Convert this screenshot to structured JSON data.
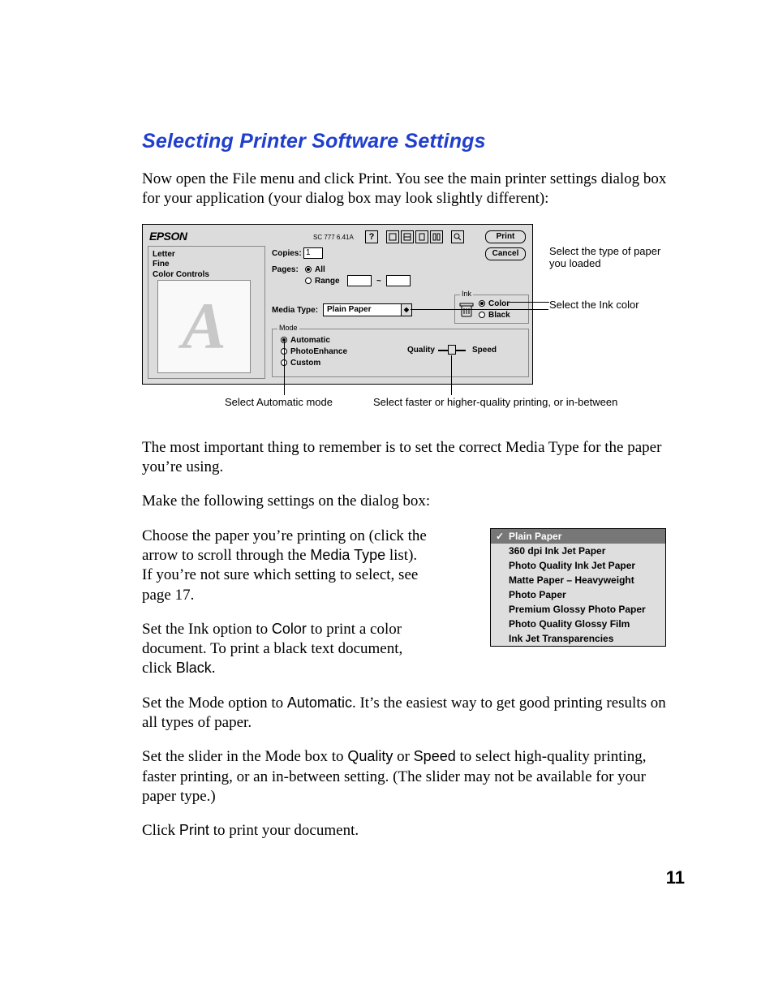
{
  "title": "Selecting Printer Software Settings",
  "intro": "Now open the File menu and click Print. You see the main printer settings dialog box for your application (your dialog box may look slightly different):",
  "after1": "The most important thing to remember is to set the correct Media Type for the paper you’re using.",
  "after2": "Make the following settings on the dialog box:",
  "step1a": "Choose the paper you’re printing on (click the arrow to scroll through the ",
  "step1_term": "Media Type",
  "step1b": " list). If you’re not sure which setting to select, see page 17.",
  "step2a": "Set the Ink option to ",
  "step2_term1": "Color",
  "step2b": " to print a color document. To print a black text document, click ",
  "step2_term2": "Black",
  "step2c": ".",
  "step3a": "Set the Mode option to ",
  "step3_term": "Automatic",
  "step3b": ". It’s the easiest way to get good printing results on all types of paper.",
  "step4a": "Set the slider in the Mode box to ",
  "step4_term1": "Quality",
  "step4b": " or ",
  "step4_term2": "Speed",
  "step4c": " to select high-quality printing, faster printing, or an in-between setting. (The slider may not be available for your paper type.)",
  "step5a": "Click ",
  "step5_term": "Print",
  "step5b": " to print your document.",
  "page_number": "11",
  "dialog": {
    "brand": "EPSON",
    "version": "SC 777 6.41A",
    "print_label": "Print",
    "cancel_label": "Cancel",
    "help_label": "?",
    "summary": {
      "line1": "Letter",
      "line2": "Fine",
      "line3": "Color Controls"
    },
    "preview_letter": "A",
    "copies_label": "Copies:",
    "copies_value": "1",
    "pages_label": "Pages:",
    "pages_all": "All",
    "pages_range": "Range",
    "range_tilde": "~",
    "media_label": "Media Type:",
    "media_value": "Plain Paper",
    "ink_legend": "Ink",
    "ink_color": "Color",
    "ink_black": "Black",
    "mode_legend": "Mode",
    "mode_auto": "Automatic",
    "mode_photo": "PhotoEnhance",
    "mode_custom": "Custom",
    "quality_label": "Quality",
    "speed_label": "Speed"
  },
  "annotations": {
    "paper": "Select the type of paper you loaded",
    "ink": "Select the Ink color",
    "auto": "Select Automatic mode",
    "slider": "Select faster or higher-quality printing, or in-between"
  },
  "media_options": [
    "Plain Paper",
    "360 dpi Ink Jet Paper",
    "Photo Quality Ink Jet Paper",
    "Matte Paper – Heavyweight",
    "Photo Paper",
    "Premium Glossy Photo Paper",
    "Photo Quality Glossy Film",
    "Ink Jet Transparencies"
  ]
}
